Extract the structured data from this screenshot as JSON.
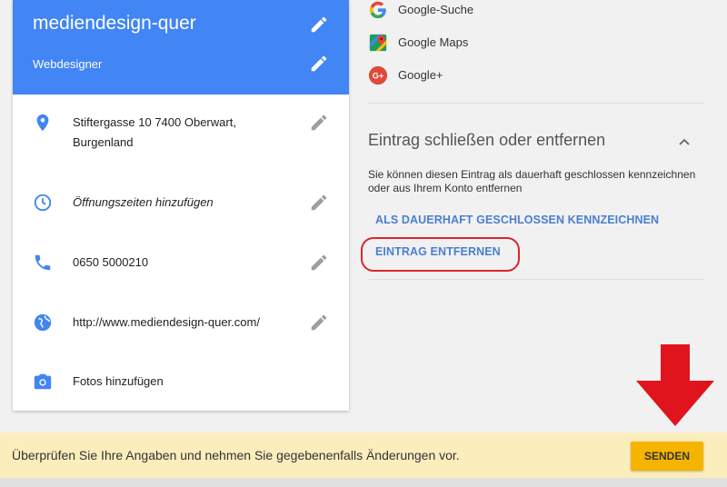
{
  "business": {
    "name": "mediendesign-quer",
    "category": "Webdesigner"
  },
  "info_rows": [
    {
      "icon": "location-pin-icon",
      "text_line1": "Stiftergasse 10 7400 Oberwart,",
      "text_line2": "Burgenland"
    },
    {
      "icon": "clock-icon",
      "text": "Öffnungszeiten hinzufügen"
    },
    {
      "icon": "phone-icon",
      "text": "0650 5000210"
    },
    {
      "icon": "globe-icon",
      "text": "http://www.mediendesign-quer.com/"
    },
    {
      "icon": "camera-icon",
      "text": "Fotos hinzufügen"
    }
  ],
  "apps": [
    {
      "icon": "google-search-icon",
      "label": "Google-Suche"
    },
    {
      "icon": "google-maps-icon",
      "label": "Google Maps"
    },
    {
      "icon": "google-plus-icon",
      "label": "Google+"
    }
  ],
  "close_section": {
    "title": "Eintrag schließen oder entfernen",
    "description": "Sie können diesen Eintrag als dauerhaft geschlossen kennzeichnen oder aus Ihrem Konto entfernen",
    "mark_closed_label": "ALS DAUERHAFT GESCHLOSSEN KENNZEICHNEN",
    "remove_label": "EINTRAG ENTFERNEN"
  },
  "bottom_bar": {
    "message": "Überprüfen Sie Ihre Angaben und nehmen Sie gegebenenfalls Änderungen vor.",
    "send_label": "SENDEN"
  },
  "colors": {
    "header_blue": "#4285f4",
    "link_blue": "#4a7fd1",
    "annotation_red": "#e0141c",
    "button_yellow": "#f4b400",
    "bar_yellow": "#fcedbd"
  }
}
